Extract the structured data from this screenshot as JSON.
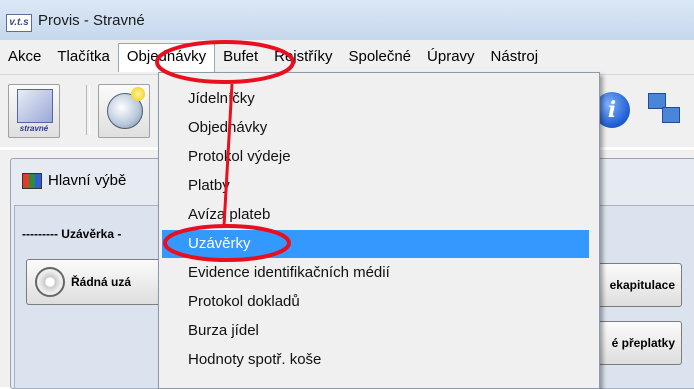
{
  "window": {
    "logo_text": "v.t.s",
    "title": "Provis - Stravné"
  },
  "menubar": {
    "items": [
      {
        "label": "Akce"
      },
      {
        "label": "Tlačítka"
      },
      {
        "label": "Objednávky"
      },
      {
        "label": "Bufet"
      },
      {
        "label": "Rejstříky"
      },
      {
        "label": "Společné"
      },
      {
        "label": "Úpravy"
      },
      {
        "label": "Nástroj"
      }
    ]
  },
  "toolbar": {
    "stravne_label": "stravné",
    "icons": [
      "stravne-icon",
      "clock-icon",
      "info-icon",
      "network-icon"
    ]
  },
  "panel": {
    "title": "Hlavní výbě",
    "section_title": "--------- Uzávěrka -",
    "buttons": {
      "radna": "Řádná uzá",
      "rekapitulace": "ekapitulace",
      "preplatky": "é přeplatky"
    }
  },
  "dropdown": {
    "items": [
      {
        "label": "Jídelníčky"
      },
      {
        "label": "Objednávky"
      },
      {
        "label": "Protokol výdeje"
      },
      {
        "label": "Platby"
      },
      {
        "label": "Avíza plateb"
      },
      {
        "label": "Uzávěrky",
        "highlighted": true
      },
      {
        "label": "Evidence identifikačních médií"
      },
      {
        "label": "Protokol dokladů"
      },
      {
        "label": "Burza jídel"
      },
      {
        "label": "Hodnoty spotř. koše"
      }
    ]
  },
  "colors": {
    "highlight": "#3399ff",
    "annotation": "#e8101f"
  }
}
